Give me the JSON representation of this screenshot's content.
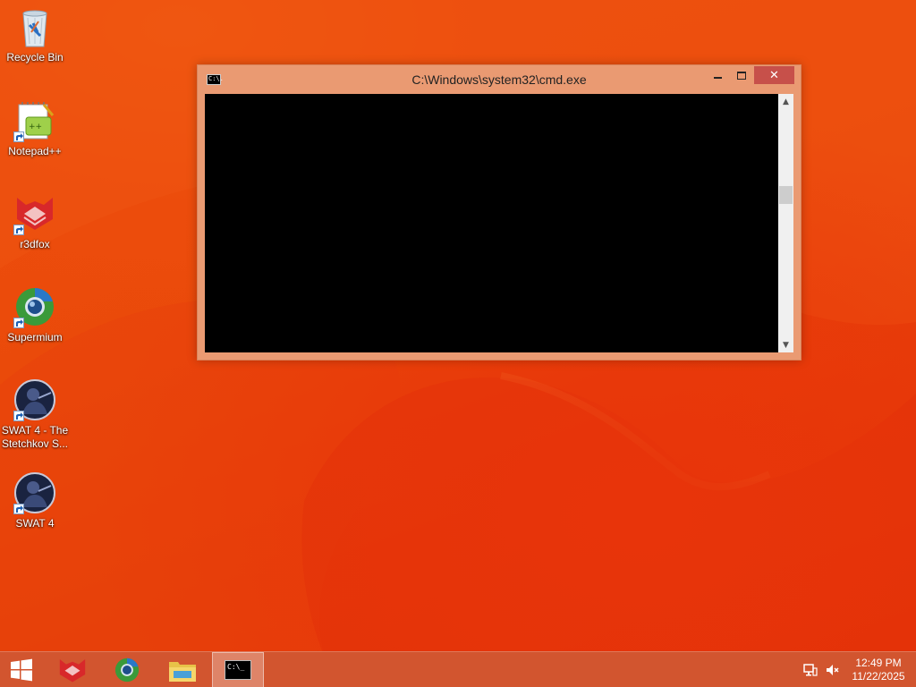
{
  "desktop": {
    "icons": [
      {
        "label": "Recycle Bin",
        "icon": "recycle-bin-icon",
        "shortcut": false
      },
      {
        "label": "Notepad++",
        "icon": "notepad-plus-plus-icon",
        "shortcut": true
      },
      {
        "label": "r3dfox",
        "icon": "r3dfox-icon",
        "shortcut": true
      },
      {
        "label": "Supermium",
        "icon": "supermium-icon",
        "shortcut": true
      },
      {
        "label": "SWAT 4 - The Stetchkov S...",
        "icon": "swat4-stetchkov-icon",
        "shortcut": true
      },
      {
        "label": "SWAT 4",
        "icon": "swat4-icon",
        "shortcut": true
      }
    ]
  },
  "cmd_window": {
    "title": "C:\\Windows\\system32\\cmd.exe",
    "system_icon_text": "C:\\.",
    "close_glyph": "✕",
    "scroll_up_glyph": "▲",
    "scroll_down_glyph": "▼",
    "console_text": ""
  },
  "taskbar": {
    "start": "windows-logo-icon",
    "items": [
      {
        "icon": "r3dfox-icon",
        "active": false
      },
      {
        "icon": "supermium-icon",
        "active": false
      },
      {
        "icon": "file-explorer-icon",
        "active": false
      },
      {
        "icon": "cmd-icon",
        "active": true
      }
    ],
    "cmd_icon_text": "C:\\_",
    "tray": {
      "network": "network-icon",
      "volume": "volume-muted-icon",
      "time": "12:49 PM",
      "date": "11/22/2025"
    }
  },
  "colors": {
    "wallpaper": "#e8400a",
    "window_frame": "#ea9a72",
    "close_button": "#c7504a",
    "console_bg": "#000000"
  }
}
